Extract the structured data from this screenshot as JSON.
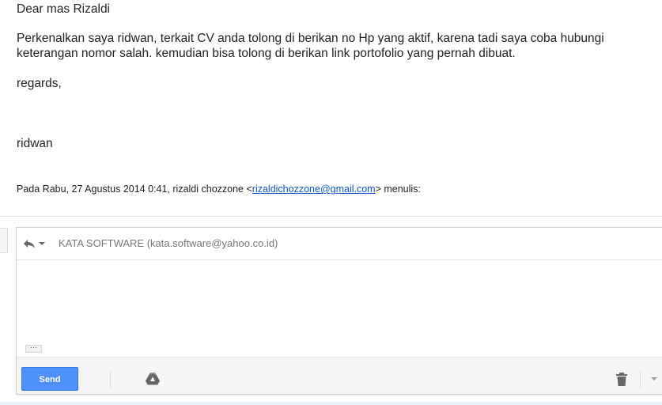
{
  "message": {
    "greeting": "Dear mas Rizaldi",
    "paragraph": "Perkenalkan saya ridwan, terkait CV anda tolong di berikan no Hp yang aktif, karena tadi saya coba hubungi keterangan nomor salah. kemudian bisa tolong di berikan link portofolio yang pernah dibuat.",
    "closing": "regards,",
    "signature": "ridwan"
  },
  "quote": {
    "prefix": "Pada Rabu, 27 Agustus 2014 0:41, rizaldi chozzone <",
    "email": "rizaldichozzone@gmail.com",
    "suffix": "> menulis:"
  },
  "composer": {
    "reply_type_icon": "reply-arrow-icon",
    "recipient": "KATA SOFTWARE (kata.software@yahoo.co.id)",
    "trim_label": "···",
    "send_label": "Send",
    "drive_icon": "google-drive-icon",
    "trash_icon": "trash-icon",
    "more_icon": "chevron-down-icon"
  },
  "colors": {
    "send_button": "#4d90fe",
    "link": "#1155cc"
  }
}
